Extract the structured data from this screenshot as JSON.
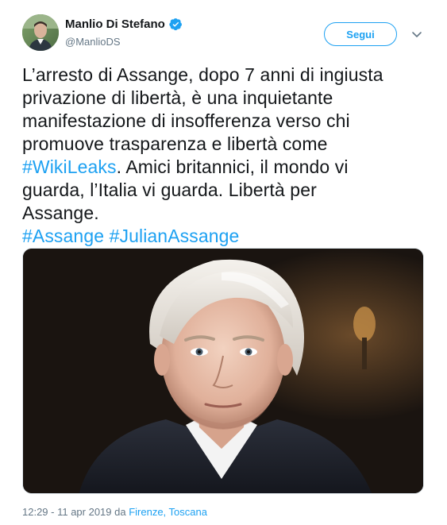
{
  "user": {
    "display_name": "Manlio Di Stefano",
    "handle": "@ManlioDS",
    "verified_icon": "verified-badge-icon"
  },
  "actions": {
    "follow_label": "Segui",
    "menu_icon": "chevron-down-icon"
  },
  "tweet": {
    "lines": [
      "L’arresto di Assange, dopo 7 anni di ingiusta",
      "privazione di libertà, è una inquietante",
      "manifestazione di insofferenza verso chi",
      "promuove trasparenza e libertà come"
    ],
    "line5_hashtag": "#WikiLeaks",
    "line5_rest": ". Amici britannici, il mondo vi",
    "line6": "guarda, l’Italia vi guarda. Libertà per",
    "line7": "Assange.",
    "hashtag_assange": "#Assange",
    "hashtag_julian": "#JulianAssange"
  },
  "meta": {
    "timestamp": "12:29 - 11 apr 2019 da ",
    "location": "Firenze, Toscana"
  },
  "colors": {
    "accent": "#1da1f2",
    "text": "#14171a",
    "muted": "#657786"
  }
}
